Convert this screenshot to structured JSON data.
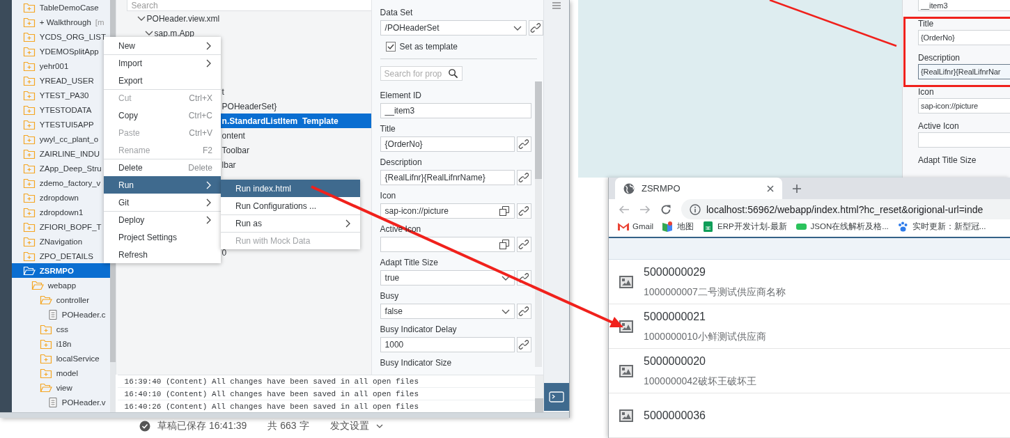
{
  "ide": {
    "project_tree": [
      {
        "label": "TableDemoCase",
        "kind": "folder",
        "expanded": false,
        "selected": false
      },
      {
        "label": "+ Walkthrough",
        "tag": "[m",
        "kind": "folder",
        "expanded": false,
        "selected": false
      },
      {
        "label": "YCDS_ORG_LIST",
        "kind": "folder",
        "expanded": false,
        "selected": false
      },
      {
        "label": "YDEMOSplitApp",
        "kind": "folder",
        "expanded": false,
        "selected": false
      },
      {
        "label": "yehr001",
        "kind": "folder",
        "expanded": false,
        "selected": false
      },
      {
        "label": "YREAD_USER",
        "kind": "folder",
        "expanded": false,
        "selected": false
      },
      {
        "label": "YTEST_PA30",
        "kind": "folder",
        "expanded": false,
        "selected": false
      },
      {
        "label": "YTESTODATA",
        "kind": "folder",
        "expanded": false,
        "selected": false
      },
      {
        "label": "YTESTUI5APP",
        "kind": "folder",
        "expanded": false,
        "selected": false
      },
      {
        "label": "ywyl_cc_plant_o",
        "kind": "folder",
        "expanded": false,
        "selected": false
      },
      {
        "label": "ZAIRLINE_INDU",
        "kind": "folder",
        "expanded": false,
        "selected": false
      },
      {
        "label": "ZApp_Deep_Stru",
        "kind": "folder",
        "expanded": false,
        "selected": false
      },
      {
        "label": "zdemo_factory_v",
        "kind": "folder",
        "expanded": false,
        "selected": false
      },
      {
        "label": "zdropdown",
        "kind": "folder",
        "expanded": false,
        "selected": false
      },
      {
        "label": "zdropdown1",
        "kind": "folder",
        "expanded": false,
        "selected": false
      },
      {
        "label": "ZFIORI_BOPF_T",
        "kind": "folder",
        "expanded": false,
        "selected": false
      },
      {
        "label": "ZNavigation",
        "kind": "folder",
        "expanded": false,
        "selected": false
      },
      {
        "label": "ZPO_DETAILS",
        "kind": "folder",
        "expanded": false,
        "selected": false
      },
      {
        "label": "ZSRMPO",
        "kind": "folder",
        "expanded": true,
        "selected": true,
        "children": [
          {
            "label": "webapp",
            "kind": "folder",
            "expanded": true,
            "selected": false,
            "children": [
              {
                "label": "controller",
                "kind": "folder",
                "expanded": true,
                "selected": false,
                "children": [
                  {
                    "label": "POHeader.c",
                    "kind": "file",
                    "selected": false
                  }
                ]
              },
              {
                "label": "css",
                "kind": "folder",
                "expanded": false,
                "selected": false
              },
              {
                "label": "i18n",
                "kind": "folder",
                "expanded": false,
                "selected": false
              },
              {
                "label": "localService",
                "kind": "folder",
                "expanded": false,
                "selected": false
              },
              {
                "label": "model",
                "kind": "folder",
                "expanded": false,
                "selected": false
              },
              {
                "label": "view",
                "kind": "folder",
                "expanded": true,
                "selected": false,
                "children": [
                  {
                    "label": "POHeader.v",
                    "kind": "file",
                    "selected": false
                  }
                ]
              }
            ]
          }
        ]
      }
    ],
    "outline": {
      "search": {
        "placeholder": "Search"
      },
      "tree": [
        {
          "label": "POHeader.view.xml",
          "expanded": true,
          "children": [
            {
              "label": "sap.m.App",
              "expanded": true
            }
          ]
        }
      ],
      "covered_rows": [
        {
          "label": "t",
          "selected": false
        },
        {
          "label": "POHeaderSet}",
          "selected": false
        },
        {
          "label": "n.StandardListItem  Template",
          "selected": true
        },
        {
          "label": "ontent",
          "selected": false
        },
        {
          "label": "Toolbar",
          "selected": false
        },
        {
          "label": "lbar",
          "selected": false
        },
        {
          "label": "0",
          "selected": false
        }
      ]
    },
    "context_menu": {
      "items": [
        {
          "label": "New",
          "submenu": true,
          "disabled": false,
          "selected": false,
          "divider_before": false
        },
        {
          "label": "Import",
          "submenu": true,
          "disabled": false,
          "selected": false,
          "divider_before": true
        },
        {
          "label": "Export",
          "submenu": false,
          "disabled": false,
          "selected": false,
          "divider_before": false
        },
        {
          "label": "Cut",
          "shortcut": "Ctrl+X",
          "submenu": false,
          "disabled": true,
          "selected": false,
          "divider_before": true
        },
        {
          "label": "Copy",
          "shortcut": "Ctrl+C",
          "submenu": false,
          "disabled": false,
          "selected": false,
          "divider_before": false
        },
        {
          "label": "Paste",
          "shortcut": "Ctrl+V",
          "submenu": false,
          "disabled": true,
          "selected": false,
          "divider_before": false
        },
        {
          "label": "Rename",
          "shortcut": "F2",
          "submenu": false,
          "disabled": true,
          "selected": false,
          "divider_before": false
        },
        {
          "label": "Delete",
          "shortcut": "Delete",
          "submenu": false,
          "disabled": false,
          "selected": false,
          "divider_before": true
        },
        {
          "label": "Run",
          "submenu": true,
          "disabled": false,
          "selected": true,
          "divider_before": false
        },
        {
          "label": "Git",
          "submenu": true,
          "disabled": false,
          "selected": false,
          "divider_before": false
        },
        {
          "label": "Deploy",
          "submenu": true,
          "disabled": false,
          "selected": false,
          "divider_before": true
        },
        {
          "label": "Project Settings",
          "submenu": false,
          "disabled": false,
          "selected": false,
          "divider_before": false
        },
        {
          "label": "Refresh",
          "submenu": false,
          "disabled": false,
          "selected": false,
          "divider_before": false
        }
      ]
    },
    "run_submenu": {
      "items": [
        {
          "label": "Run index.html",
          "submenu": false,
          "disabled": false,
          "selected": true,
          "divider_before": false
        },
        {
          "label": "Run Configurations ...",
          "submenu": false,
          "disabled": false,
          "selected": false,
          "divider_before": false
        },
        {
          "label": "Run as",
          "submenu": true,
          "disabled": false,
          "selected": false,
          "divider_before": true
        },
        {
          "label": "Run with Mock Data",
          "submenu": false,
          "disabled": true,
          "selected": false,
          "divider_before": true
        }
      ]
    },
    "properties": {
      "data_set": {
        "label": "Data Set",
        "value": "/POHeaderSet"
      },
      "template": {
        "label": "Set as template",
        "checked": true
      },
      "search": {
        "placeholder": "Search for prop"
      },
      "fields": [
        {
          "label": "Element ID",
          "value": "__item3",
          "kind": "text"
        },
        {
          "label": "Title",
          "value": "{OrderNo}",
          "kind": "bound"
        },
        {
          "label": "Description",
          "value": "{RealLifnr}{RealLifnrName}",
          "kind": "bound"
        },
        {
          "label": "Icon",
          "value": "sap-icon://picture",
          "kind": "icon"
        },
        {
          "label": "Active Icon",
          "kind": "icon"
        },
        {
          "label": "Adapt Title Size",
          "value": "true",
          "kind": "select"
        },
        {
          "label": "Busy",
          "value": "false",
          "kind": "select"
        },
        {
          "label": "Busy Indicator Delay",
          "value": "1000",
          "kind": "bound"
        },
        {
          "label": "Busy Indicator Size",
          "kind": "label"
        }
      ]
    },
    "console": {
      "lines": [
        "16:39:40 (Content) All changes have been saved in all open files",
        "16:40:10 (Content) All changes have been saved in all open files",
        "16:40:26 (Content) All changes have been saved in all open files"
      ]
    }
  },
  "snippet_panel": {
    "fields": [
      {
        "value": "__item3",
        "focused": false
      },
      {
        "label": "Title",
        "value": "{OrderNo}",
        "focused": false
      },
      {
        "label": "Description",
        "value": "{RealLifnr}{RealLifnrNar",
        "focused": true
      },
      {
        "label": "Icon",
        "value": "sap-icon://picture",
        "focused": false
      },
      {
        "label": "Active Icon",
        "focused": false
      },
      {
        "label": "Adapt Title Size"
      }
    ]
  },
  "editor_status": {
    "saved": "草稿已保存 16:41:39",
    "count": "共 663 字",
    "settings": "发文设置"
  },
  "browser": {
    "tab": {
      "title": "ZSRMPO"
    },
    "address": {
      "url": "localhost:56962/webapp/index.html?hc_reset&origional-url=inde"
    },
    "bookmarks": [
      {
        "label": "Gmail",
        "kind": "mail"
      },
      {
        "label": "地图",
        "kind": "map"
      },
      {
        "label": "ERP开发计划-最新",
        "kind": "sheet"
      },
      {
        "label": "JSON在线解析及格...",
        "kind": "json"
      },
      {
        "label": "实时更新：新型冠...",
        "kind": "paw"
      }
    ],
    "items": [
      {
        "title": "5000000029",
        "description": "1000000007二号测试供应商名称"
      },
      {
        "title": "5000000021",
        "description": "1000000010小鲜测试供应商"
      },
      {
        "title": "5000000020",
        "description": "1000000042破坏王破坏王"
      },
      {
        "title": "5000000036"
      }
    ]
  }
}
